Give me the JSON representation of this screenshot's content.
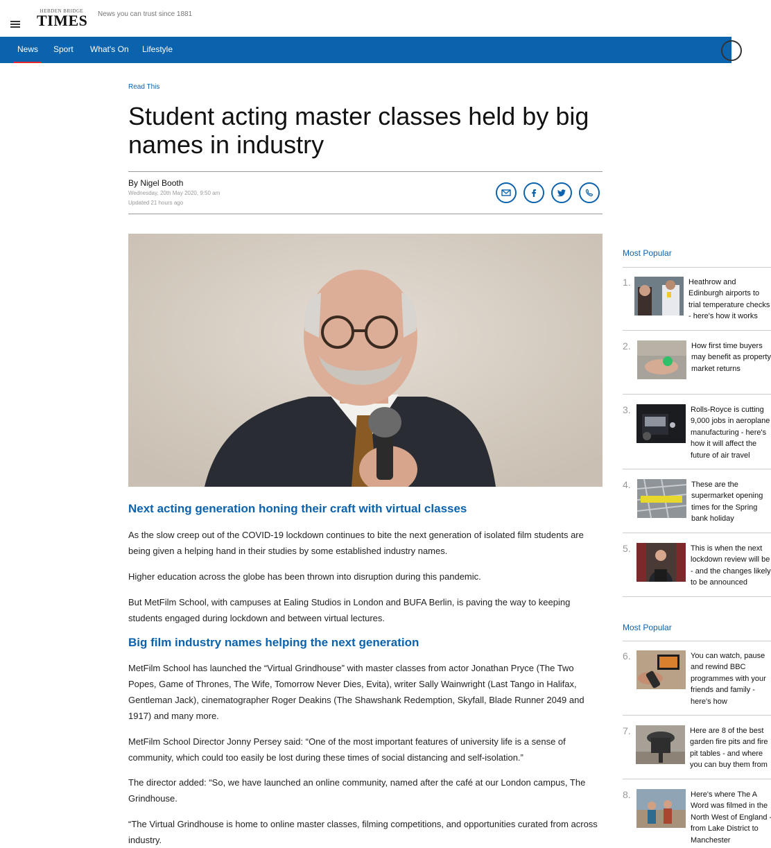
{
  "header": {
    "logo_top": "HEBDEN BRIDGE",
    "logo_main": "TIMES",
    "tagline": "News you can trust since 1881"
  },
  "nav": {
    "items": [
      {
        "label": "News",
        "active": true
      },
      {
        "label": "Sport",
        "active": false
      },
      {
        "label": "What's On",
        "active": false
      },
      {
        "label": "Lifestyle",
        "active": false
      }
    ]
  },
  "article": {
    "kicker": "Read This",
    "headline": "Student acting master classes held by big names in industry",
    "byline": "By Nigel Booth",
    "date": "Wednesday, 20th May 2020, 9:50 am",
    "updated": "Updated  21 hours ago",
    "share_icons": [
      "email-icon",
      "facebook-icon",
      "twitter-icon",
      "whatsapp-icon"
    ],
    "subheads": [
      "Next acting generation honing their craft with virtual classes",
      "Big film industry names helping the next generation"
    ],
    "paragraphs": [
      "As the slow creep out of the COVID-19 lockdown continues to bite the next generation of isolated film students are being given a helping hand in their studies by some established industry names.",
      "Higher education across the globe has been thrown into disruption during this pandemic.",
      "But MetFilm School, with campuses at Ealing Studios in London and BUFA Berlin, is paving the way to keeping students engaged during lockdown and between virtual lectures.",
      "MetFilm School has launched the “Virtual Grindhouse” with master classes from actor Jonathan Pryce (The Two Popes, Game of Thrones, The Wife, Tomorrow Never Dies, Evita), writer Sally Wainwright (Last Tango in Halifax, Gentleman Jack), cinematographer Roger Deakins (The Shawshank Redemption, Skyfall, Blade Runner 2049 and 1917) and many more.",
      "MetFilm School Director Jonny Persey said: “One of the most important features of university life is a sense of community, which could too easily be lost during these times of social distancing and self-isolation.”",
      "The director added: “So, we have launched an online community, named after the café at our London campus, The Grindhouse.",
      "“The Virtual Grindhouse is home to online master classes, filming competitions, and opportunities curated from across industry."
    ]
  },
  "sidebar": {
    "section_titles": [
      "Most Popular",
      "Most Popular"
    ],
    "items": [
      {
        "num": "1.",
        "title": "Heathrow and Edinburgh airports to trial temperature checks - here's how it works"
      },
      {
        "num": "2.",
        "title": "How first time buyers may benefit as property market returns"
      },
      {
        "num": "3.",
        "title": "Rolls-Royce is cutting 9,000 jobs in aeroplane manufacturing - here's how it will affect the future of air travel"
      },
      {
        "num": "4.",
        "title": "These are the supermarket opening times for the Spring bank holiday"
      },
      {
        "num": "5.",
        "title": "This is when the next lockdown review will be - and the changes likely to be announced"
      },
      {
        "num": "6.",
        "title": "You can watch, pause and rewind BBC programmes with your friends and family - here's how"
      },
      {
        "num": "7.",
        "title": "Here are 8 of the best garden fire pits and fire pit tables - and where you can buy them from"
      },
      {
        "num": "8.",
        "title": "Here's where The A Word was filmed in the North West of England - from Lake District to Manchester"
      }
    ]
  },
  "colors": {
    "brand_blue": "#0b62ad",
    "active_underline": "#e3262b"
  }
}
